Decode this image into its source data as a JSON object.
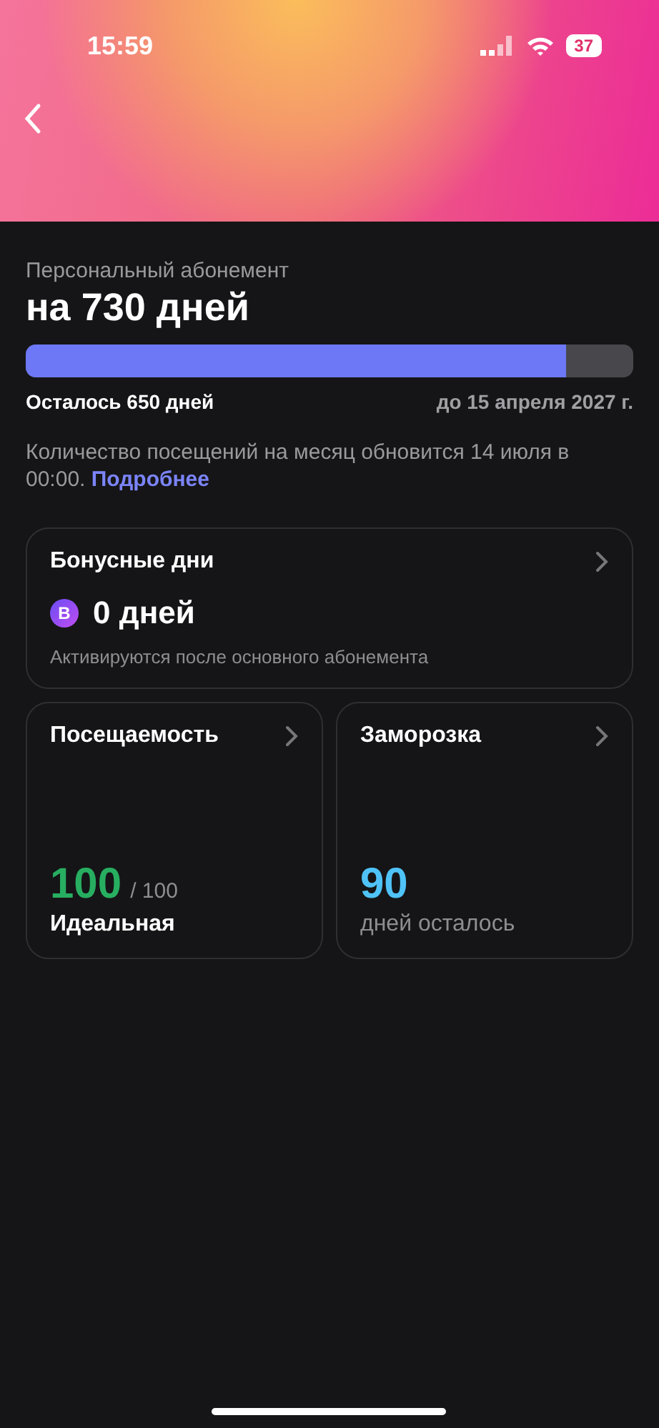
{
  "status_bar": {
    "time": "15:59",
    "battery": "37"
  },
  "subscription": {
    "caption": "Персональный абонемент",
    "title": "на 730 дней",
    "progress": {
      "level": 0.89
    },
    "remaining": "Осталось 650 дней",
    "until": "до 15 апреля 2027 г.",
    "note": "Количество посещений на месяц обновится 14 июля в 00:00.",
    "link": "Подробнее"
  },
  "bonus_card": {
    "title": "Бонусные дни",
    "badge": "В",
    "value": "0 дней",
    "hint": "Активируются после основного абонемента"
  },
  "cards": [
    {
      "kind": "attendance",
      "title": "Посещаемость",
      "value": "100",
      "color": "#27ae60",
      "max": "/ 100",
      "label": "Идеальная"
    },
    {
      "kind": "freeze",
      "title": "Заморозка",
      "value": "90",
      "color": "#4fc3f7",
      "label": "дней осталось"
    }
  ]
}
